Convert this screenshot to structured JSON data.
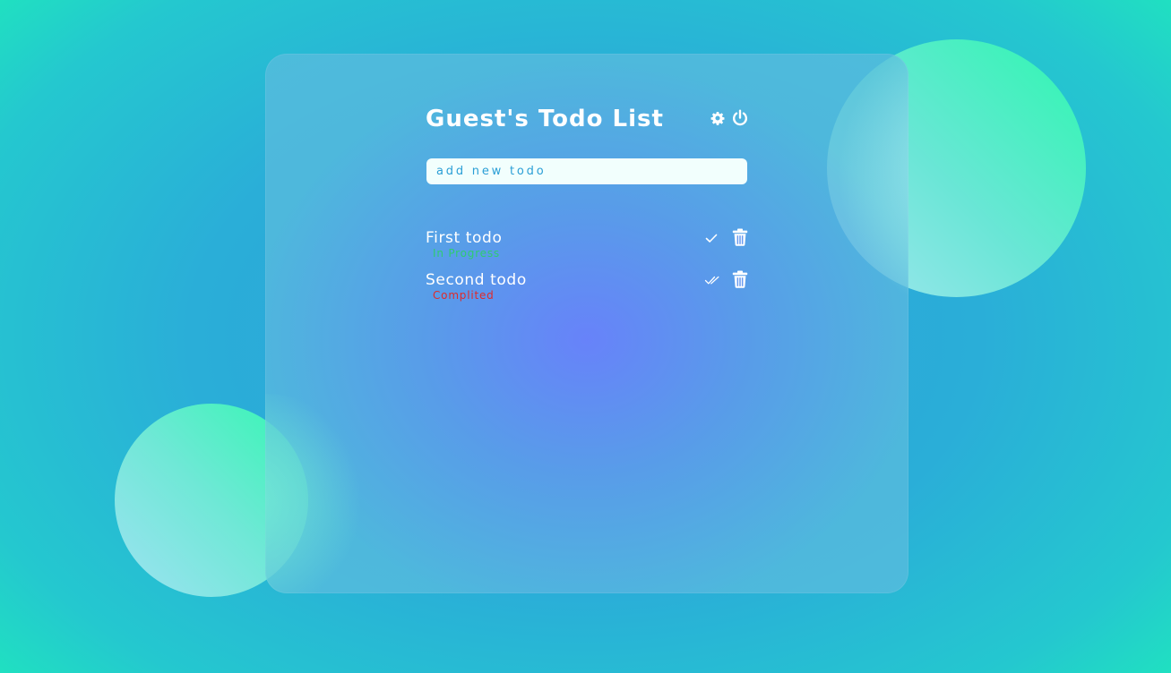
{
  "header": {
    "title": "Guest's Todo List",
    "settings_icon": "gear-icon",
    "logout_icon": "power-icon"
  },
  "input": {
    "placeholder": "add new todo",
    "value": ""
  },
  "todos": [
    {
      "title": "First todo",
      "status": "In Progress",
      "status_color": "#2ecc71",
      "action_icon": "check-icon",
      "delete_icon": "trash-icon"
    },
    {
      "title": "Second todo",
      "status": "Complited",
      "status_color": "#e02a2a",
      "action_icon": "double-check-icon",
      "delete_icon": "trash-icon"
    }
  ],
  "colors": {
    "background_edge": "#1df3b6",
    "background_center": "#2f9fdc",
    "card_center": "#6c80fc",
    "text": "#ffffff",
    "input_text": "#2b9fd6"
  }
}
